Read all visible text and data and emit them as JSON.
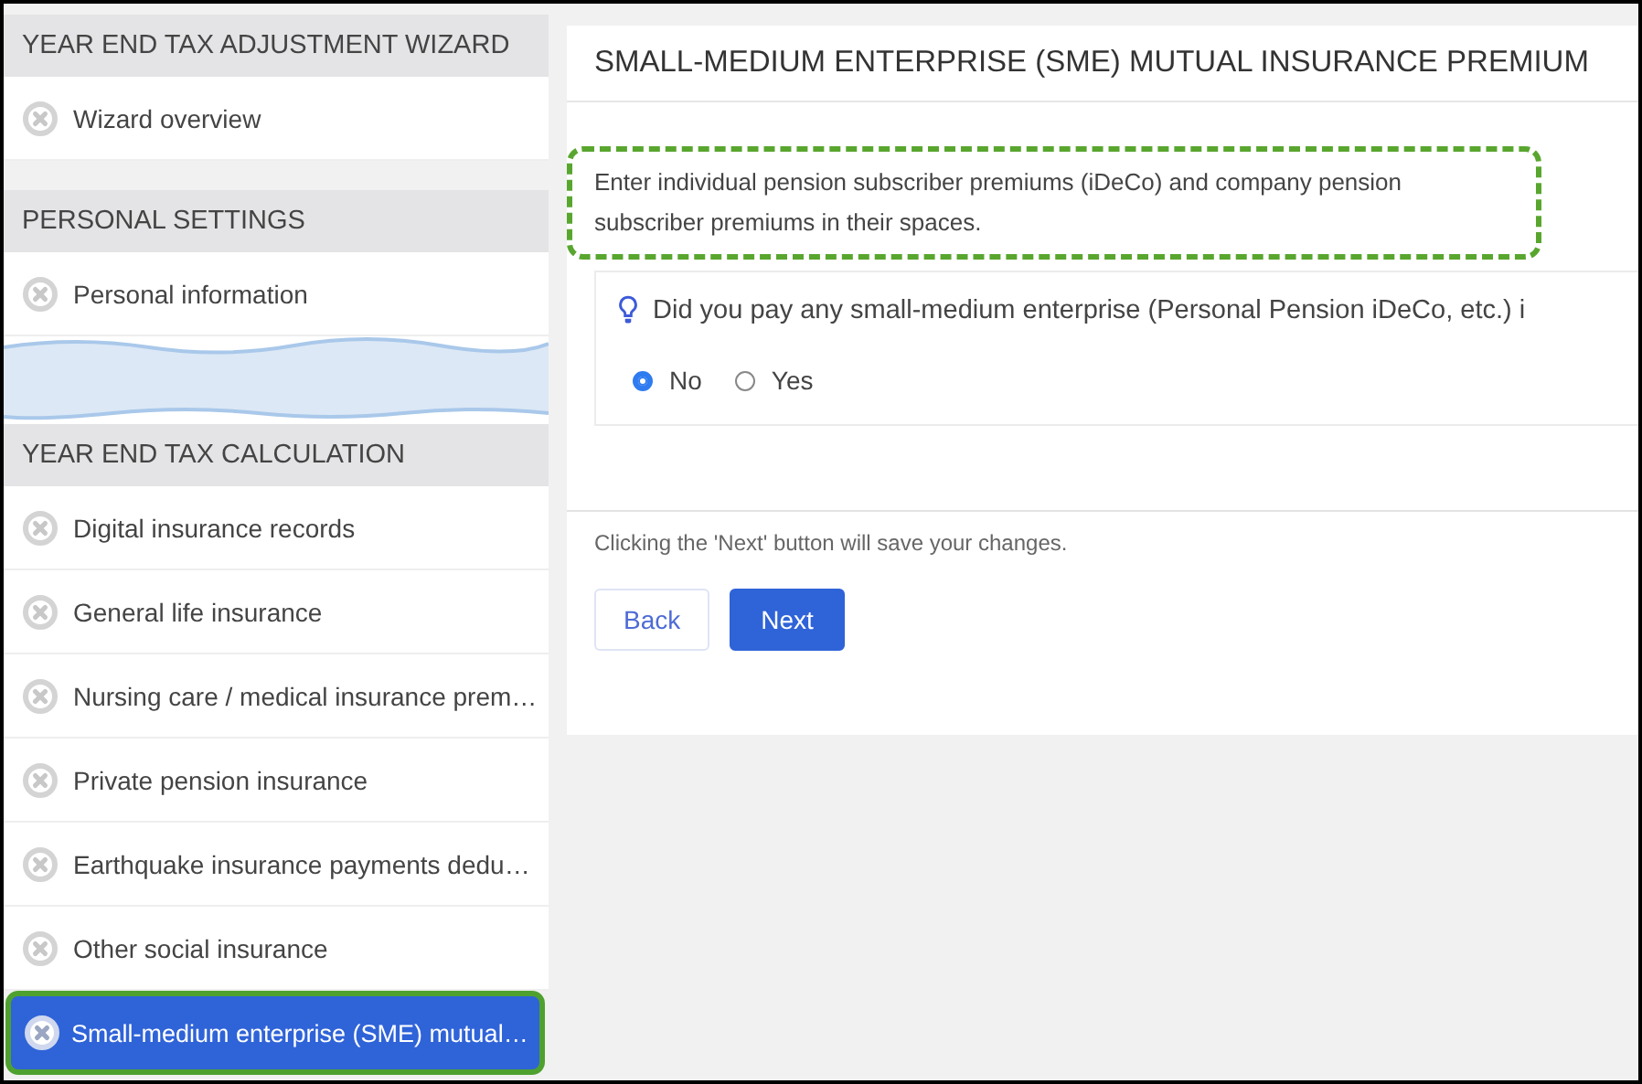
{
  "sidebar": {
    "sections": [
      {
        "title": "YEAR END TAX ADJUSTMENT WIZARD",
        "items": [
          {
            "label": "Wizard overview",
            "selected": false
          }
        ]
      },
      {
        "title": "PERSONAL SETTINGS",
        "items": [
          {
            "label": "Personal information",
            "selected": false
          }
        ]
      },
      {
        "title": "YEAR END TAX CALCULATION",
        "items": [
          {
            "label": "Digital insurance records",
            "selected": false
          },
          {
            "label": "General life insurance",
            "selected": false
          },
          {
            "label": "Nursing care / medical insurance prem…",
            "selected": false
          },
          {
            "label": "Private pension insurance",
            "selected": false
          },
          {
            "label": "Earthquake insurance payments dedu…",
            "selected": false
          },
          {
            "label": "Other social insurance",
            "selected": false
          },
          {
            "label": "Small-medium enterprise (SME) mutual…",
            "selected": true
          }
        ]
      }
    ]
  },
  "main": {
    "title": "SMALL-MEDIUM ENTERPRISE (SME) MUTUAL INSURANCE PREMIUM",
    "instruction": "Enter individual pension subscriber premiums (iDeCo) and company pension subscriber premiums in their spaces.",
    "question": "Did you pay any small-medium enterprise (Personal Pension iDeCo, etc.) i",
    "options": [
      {
        "label": "No",
        "selected": true
      },
      {
        "label": "Yes",
        "selected": false
      }
    ],
    "save_note": "Clicking the 'Next' button will save your changes.",
    "buttons": [
      {
        "label": "Back",
        "kind": "secondary"
      },
      {
        "label": "Next",
        "kind": "primary"
      }
    ]
  }
}
